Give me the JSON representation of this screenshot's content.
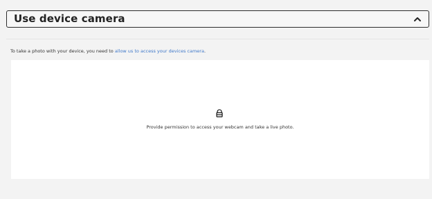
{
  "section": {
    "title": "Use device camera",
    "toggle_icon": "chevron-up-icon"
  },
  "intro": {
    "prefix": "To take a photo with your device, you need to ",
    "link_text": "allow us to access your devices camera",
    "suffix": "."
  },
  "camera_panel": {
    "icon": "lock-icon",
    "message": "Provide permission to access your webcam and take a live photo."
  },
  "colors": {
    "page_background": "#f3f3f3",
    "panel_background": "#ffffff",
    "link": "#3f78c9",
    "border": "#2b2b2b",
    "text": "#222222"
  }
}
